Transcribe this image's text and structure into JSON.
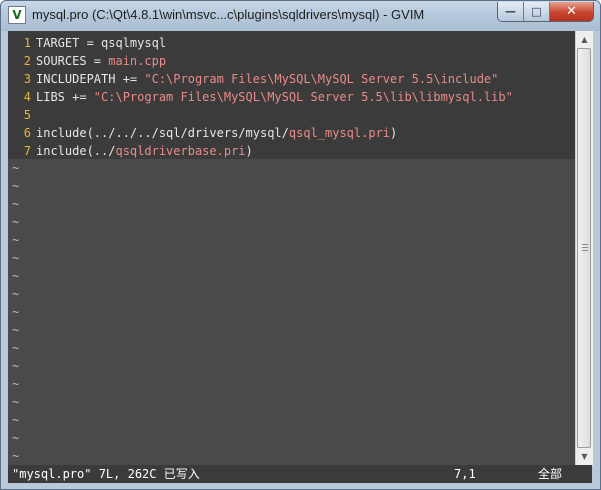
{
  "window": {
    "title": "mysql.pro (C:\\Qt\\4.8.1\\win\\msvc...c\\plugins\\sqldrivers\\mysql) - GVIM",
    "icon": "gvim-icon",
    "controls": {
      "minimize": "minimize-icon",
      "maximize": "maximize-icon",
      "close": "close-icon"
    }
  },
  "buffer": {
    "lines": [
      {
        "num": "1",
        "parts": [
          {
            "text": "TARGET = qsqlmysql",
            "kind": "normal"
          }
        ]
      },
      {
        "num": "2",
        "parts": [
          {
            "text": "SOURCES = ",
            "kind": "normal"
          },
          {
            "text": "main.cpp",
            "kind": "string"
          }
        ]
      },
      {
        "num": "3",
        "parts": [
          {
            "text": "INCLUDEPATH += ",
            "kind": "normal"
          },
          {
            "text": "\"C:\\Program Files\\MySQL\\MySQL Server 5.5\\include\"",
            "kind": "string"
          }
        ]
      },
      {
        "num": "4",
        "parts": [
          {
            "text": "LIBS += ",
            "kind": "normal"
          },
          {
            "text": "\"C:\\Program Files\\MySQL\\MySQL Server 5.5\\lib\\libmysql.lib\"",
            "kind": "string"
          }
        ]
      },
      {
        "num": "5",
        "parts": []
      },
      {
        "num": "6",
        "parts": [
          {
            "text": "include(../../../sql/drivers/mysql/",
            "kind": "normal"
          },
          {
            "text": "qsql_mysql.pri",
            "kind": "string"
          },
          {
            "text": ")",
            "kind": "normal"
          }
        ]
      },
      {
        "num": "7",
        "parts": [
          {
            "text": "include(../",
            "kind": "normal"
          },
          {
            "text": "qsqldriverbase.pri",
            "kind": "string"
          },
          {
            "text": ")",
            "kind": "normal"
          }
        ]
      }
    ],
    "filler_char": "~",
    "filler_count": 17
  },
  "status": {
    "message": "\"mysql.pro\" 7L, 262C 已写入",
    "cursor_position": "7,1",
    "scroll_percent": "全部"
  },
  "colors": {
    "text_bg": "#3b3b3b",
    "empty_bg": "#4a4a4a",
    "line_number": "#e8b43a",
    "string": "#e98a8a",
    "normal_text": "#e6e6e6"
  }
}
